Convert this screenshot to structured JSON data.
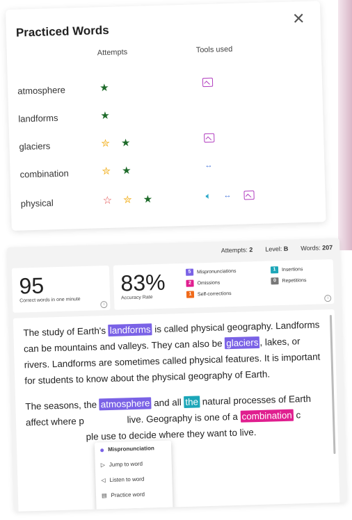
{
  "practiced": {
    "title": "Practiced Words",
    "attempts_header": "Attempts",
    "tools_header": "Tools used",
    "rows": [
      {
        "word": "atmosphere"
      },
      {
        "word": "landforms"
      },
      {
        "word": "glaciers"
      },
      {
        "word": "combination"
      },
      {
        "word": "physical"
      }
    ]
  },
  "stats": {
    "attempts_label": "Attempts:",
    "attempts_value": "2",
    "level_label": "Level:",
    "level_value": "B",
    "words_label": "Words:",
    "words_value": "207"
  },
  "cards": {
    "correct_value": "95",
    "correct_label": "Correct words in one minute",
    "accuracy_value": "83%",
    "accuracy_label": "Accuracy Rate"
  },
  "legend": [
    {
      "count": "5",
      "label": "Mispronunciations",
      "color": "#7a62e6"
    },
    {
      "count": "2",
      "label": "Omissions",
      "color": "#e01e8f"
    },
    {
      "count": "1",
      "label": "Self-corrections",
      "color": "#f06a1a"
    },
    {
      "count": "1",
      "label": "Insertions",
      "color": "#1ca6b8"
    },
    {
      "count": "0",
      "label": "Repetitions",
      "color": "#777777"
    }
  ],
  "passage": {
    "p1": [
      "The study of Earth's ",
      "landforms",
      " is called physical geography. Landforms can be mountains and valleys. They can also be ",
      "glaciers",
      ", lakes, or rivers. Landforms are sometimes called physical features. It is important for students to know about the physical geography of Earth."
    ],
    "p2": [
      "The seasons, the ",
      "atmosphere",
      " and all ",
      "the",
      " natural processes of Earth affect where p",
      " live. Geography is one of a ",
      "combination",
      " c",
      "ple use to decide where they want to live."
    ]
  },
  "context_menu": {
    "header": "Mispronunciation",
    "items": [
      "Jump to word",
      "Listen to word",
      "Practice word"
    ]
  },
  "icons": {
    "close": "close-icon",
    "star": "star-icon",
    "image": "image-icon",
    "arrows": "arrows-icon",
    "speaker": "speaker-icon"
  }
}
